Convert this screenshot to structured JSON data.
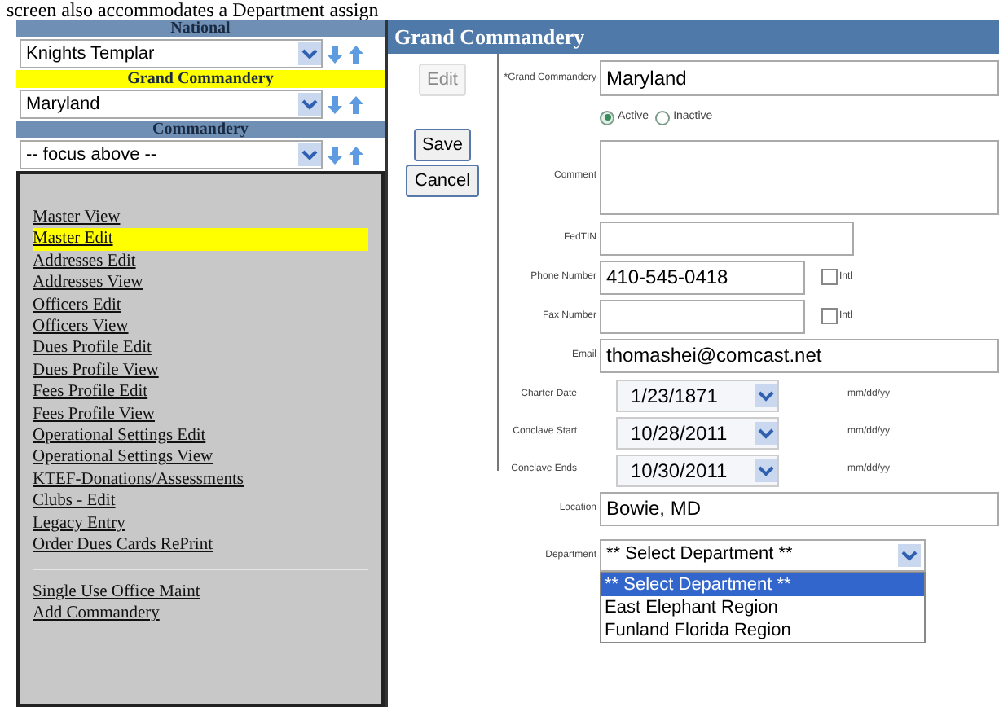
{
  "caption": "screen also accommodates a Department assign",
  "sidebar": {
    "selectors": [
      {
        "heading": "National",
        "highlighted": false,
        "value": "Knights Templar"
      },
      {
        "heading": "Grand Commandery",
        "highlighted": true,
        "value": "Maryland"
      },
      {
        "heading": "Commandery",
        "highlighted": false,
        "value": "-- focus above --"
      }
    ],
    "links": [
      {
        "label": "Master View",
        "selected": false
      },
      {
        "label": "Master Edit",
        "selected": true
      },
      {
        "label": "Addresses Edit",
        "selected": false
      },
      {
        "label": "Addresses View",
        "selected": false
      },
      {
        "label": "Officers Edit",
        "selected": false
      },
      {
        "label": "Officers View",
        "selected": false
      },
      {
        "label": "Dues Profile Edit",
        "selected": false
      },
      {
        "label": "Dues Profile View",
        "selected": false
      },
      {
        "label": "Fees Profile Edit",
        "selected": false
      },
      {
        "label": "Fees Profile View",
        "selected": false
      },
      {
        "label": "Operational Settings Edit",
        "selected": false
      },
      {
        "label": "Operational Settings View",
        "selected": false
      },
      {
        "label": "KTEF-Donations/Assessments",
        "selected": false
      },
      {
        "label": "Clubs - Edit",
        "selected": false
      },
      {
        "label": "Legacy Entry",
        "selected": false
      },
      {
        "label": "Order Dues Cards RePrint",
        "selected": false
      }
    ],
    "extra_links": [
      {
        "label": "Single Use Office Maint"
      },
      {
        "label": "Add Commandery"
      }
    ]
  },
  "panel": {
    "title": "Grand Commandery",
    "buttons": [
      {
        "label": "Edit",
        "disabled": true
      },
      {
        "label": "Save",
        "disabled": false
      },
      {
        "label": "Cancel",
        "disabled": false
      }
    ],
    "name_label": "*Grand Commandery",
    "name_value": "Maryland",
    "status": [
      {
        "label": "Active",
        "selected": true
      },
      {
        "label": "Inactive",
        "selected": false
      }
    ],
    "fields": [
      {
        "kind": "textarea",
        "label": "Comment"
      },
      {
        "kind": "text",
        "label": "FedTIN"
      },
      {
        "kind": "phone",
        "label": "Phone Number",
        "value": "410-545-0418",
        "intl_label": "Intl",
        "intl_checked": false
      },
      {
        "kind": "phone",
        "label": "Fax Number",
        "intl_label": "Intl",
        "intl_checked": false
      },
      {
        "kind": "wide",
        "label": "Email",
        "value": "thomashei@comcast.net"
      },
      {
        "kind": "date",
        "label": "Charter Date",
        "value": "1/23/1871",
        "hint": "mm/dd/yy"
      },
      {
        "kind": "date",
        "label": "Conclave Start",
        "value": "10/28/2011",
        "hint": "mm/dd/yy"
      },
      {
        "kind": "date",
        "label": "Conclave Ends",
        "value": "10/30/2011",
        "hint": "mm/dd/yy"
      },
      {
        "kind": "wide",
        "label": "Location",
        "value": "Bowie, MD"
      }
    ],
    "department": {
      "label": "Department",
      "value": "** Select Department **",
      "options": [
        {
          "label": "** Select Department **",
          "selected": true
        },
        {
          "label": "East Elephant Region",
          "selected": false
        },
        {
          "label": "Funland Florida Region",
          "selected": false
        }
      ]
    }
  }
}
